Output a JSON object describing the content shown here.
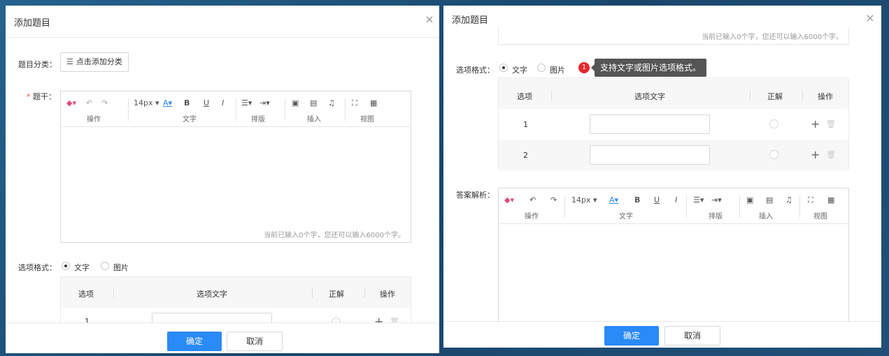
{
  "left": {
    "title": "添加题目",
    "close": "×",
    "category_label": "题目分类：",
    "category_button": "点击添加分类",
    "required_mark": "*",
    "stem_label": "题干：",
    "counter": "当前已输入0个字，您还可以输入6000个字。",
    "option_format_label": "选项格式：",
    "format_text": "文字",
    "format_image": "图片",
    "table": {
      "headers": [
        "选项",
        "选项文字",
        "正解",
        "操作"
      ],
      "rows": [
        {
          "num": "1"
        }
      ]
    },
    "ok": "确定",
    "cancel": "取消"
  },
  "right": {
    "title": "添加题目",
    "close": "×",
    "counter": "当前已输入0个字，您还可以输入6000个字。",
    "option_format_label": "选项格式：",
    "format_text": "文字",
    "format_image": "图片",
    "tip_badge": "1",
    "tip_text": "支持文字或图片选项格式。",
    "table": {
      "headers": [
        "选项",
        "选项文字",
        "正解",
        "操作"
      ],
      "rows": [
        {
          "num": "1"
        },
        {
          "num": "2"
        }
      ]
    },
    "analysis_label": "答案解析：",
    "ok": "确定",
    "cancel": "取消"
  },
  "toolbar": {
    "font_size": "14px",
    "groups": [
      "操作",
      "文字",
      "排版",
      "插入",
      "视图"
    ],
    "bold": "B",
    "underline": "U",
    "italic": "I",
    "font_color": "A"
  },
  "icons": [
    "eraser-icon",
    "undo-icon",
    "redo-icon",
    "font-color-icon",
    "bold-icon",
    "underline-icon",
    "italic-icon",
    "align-icon",
    "indent-icon",
    "image-icon",
    "video-icon",
    "audio-icon",
    "fullscreen-icon",
    "preview-icon",
    "list-icon",
    "plus-icon",
    "trash-icon",
    "close-icon"
  ],
  "colors": {
    "primary": "#2a8af6",
    "badge": "#e8262d",
    "tooltip_bg": "#555555",
    "required": "#ff4444"
  }
}
